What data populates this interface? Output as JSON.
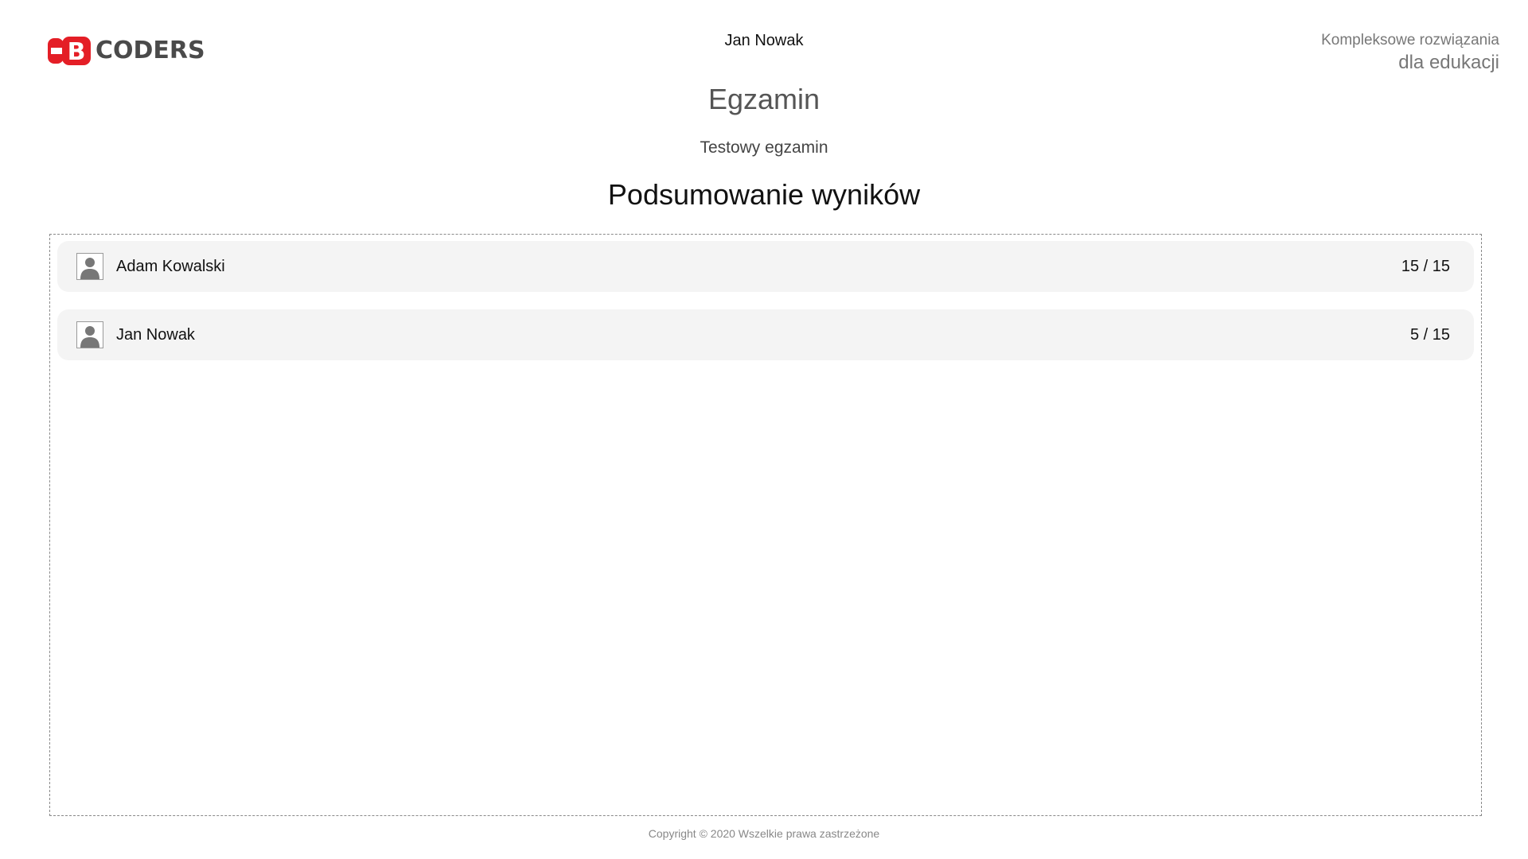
{
  "header": {
    "logo_text": "CODERS",
    "user_name": "Jan Nowak",
    "tagline_line1": "Kompleksowe rozwiązania",
    "tagline_line2": "dla edukacji"
  },
  "exam": {
    "title": "Egzamin",
    "subtitle": "Testowy egzamin",
    "summary_heading": "Podsumowanie wyników"
  },
  "results": [
    {
      "name": "Adam Kowalski",
      "score": "15 / 15",
      "icon": "user-avatar-icon"
    },
    {
      "name": "Jan Nowak",
      "score": "5 / 15",
      "icon": "user-avatar-icon"
    }
  ],
  "footer": {
    "copyright": "Copyright © 2020 Wszelkie prawa zastrzeżone"
  },
  "colors": {
    "brand_red": "#e41e26",
    "logo_gray": "#4a4a4a",
    "row_background": "#f4f4f4"
  }
}
